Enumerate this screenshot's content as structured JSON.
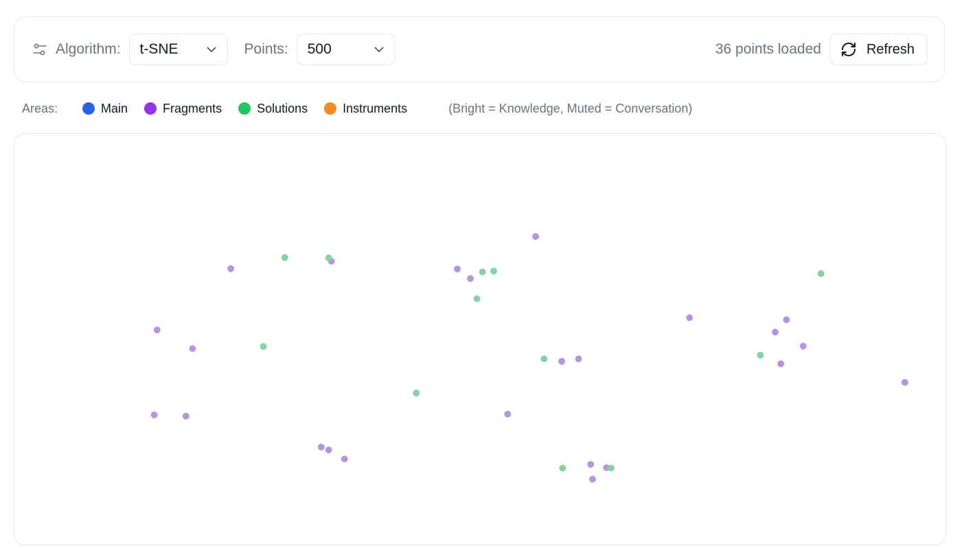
{
  "toolbar": {
    "icon": "sliders-icon",
    "algorithm_label": "Algorithm:",
    "algorithm_value": "t-SNE",
    "points_label": "Points:",
    "points_value": "500",
    "status": "36 points loaded",
    "refresh_label": "Refresh",
    "refresh_icon": "refresh-icon"
  },
  "legend": {
    "label": "Areas:",
    "items": [
      {
        "name": "Main",
        "color": "#2563eb"
      },
      {
        "name": "Fragments",
        "color": "#9333ea"
      },
      {
        "name": "Solutions",
        "color": "#22c55e"
      },
      {
        "name": "Instruments",
        "color": "#f28b22"
      }
    ],
    "note": "(Bright = Knowledge, Muted = Conversation)"
  },
  "chart_data": {
    "type": "scatter",
    "x_range": [
      0,
      1
    ],
    "y_range": [
      0,
      1
    ],
    "series": [
      {
        "name": "Fragments",
        "color": "#b894dc",
        "points": [
          [
            0.232,
            0.673
          ],
          [
            0.153,
            0.524
          ],
          [
            0.191,
            0.479
          ],
          [
            0.15,
            0.318
          ],
          [
            0.184,
            0.315
          ],
          [
            0.329,
            0.24
          ],
          [
            0.337,
            0.233
          ],
          [
            0.354,
            0.211
          ],
          [
            0.34,
            0.691
          ],
          [
            0.475,
            0.672
          ],
          [
            0.489,
            0.649
          ],
          [
            0.559,
            0.751
          ],
          [
            0.529,
            0.32
          ],
          [
            0.587,
            0.448
          ],
          [
            0.605,
            0.454
          ],
          [
            0.724,
            0.554
          ],
          [
            0.618,
            0.198
          ],
          [
            0.62,
            0.162
          ],
          [
            0.635,
            0.19
          ],
          [
            0.822,
            0.442
          ],
          [
            0.816,
            0.519
          ],
          [
            0.828,
            0.549
          ],
          [
            0.846,
            0.485
          ],
          [
            0.955,
            0.397
          ]
        ]
      },
      {
        "name": "Solutions",
        "color": "#86d1a1",
        "points": [
          [
            0.337,
            0.699
          ],
          [
            0.267,
            0.484
          ],
          [
            0.502,
            0.665
          ],
          [
            0.514,
            0.667
          ],
          [
            0.431,
            0.371
          ],
          [
            0.568,
            0.454
          ],
          [
            0.588,
            0.189
          ],
          [
            0.64,
            0.189
          ],
          [
            0.8,
            0.463
          ],
          [
            0.865,
            0.661
          ],
          [
            0.496,
            0.6
          ],
          [
            0.29,
            0.7
          ]
        ]
      }
    ]
  }
}
